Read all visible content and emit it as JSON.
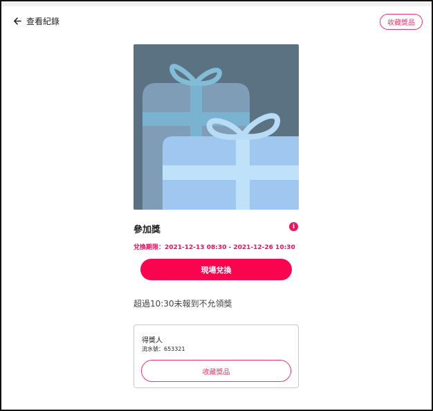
{
  "header": {
    "back_label": "查看紀錄",
    "favorite_label": "收藏獎品"
  },
  "prize": {
    "title": "參加獎",
    "info_icon_glyph": "i",
    "redeem_period": "兌換期限：2021-12-13 08:30 - 2021-12-26 10:30",
    "onsite_button_label": "現場兌換",
    "notice": "超過10:30未報到不允領獎",
    "image_icon": "gift-boxes-image"
  },
  "winner_card": {
    "label": "得獎人",
    "serial": "流水號：653321",
    "favorite_button_label": "收藏獎品"
  },
  "colors": {
    "accent": "#f8044f",
    "outline_accent": "#f0356a",
    "image_bg": "#5a7282"
  }
}
